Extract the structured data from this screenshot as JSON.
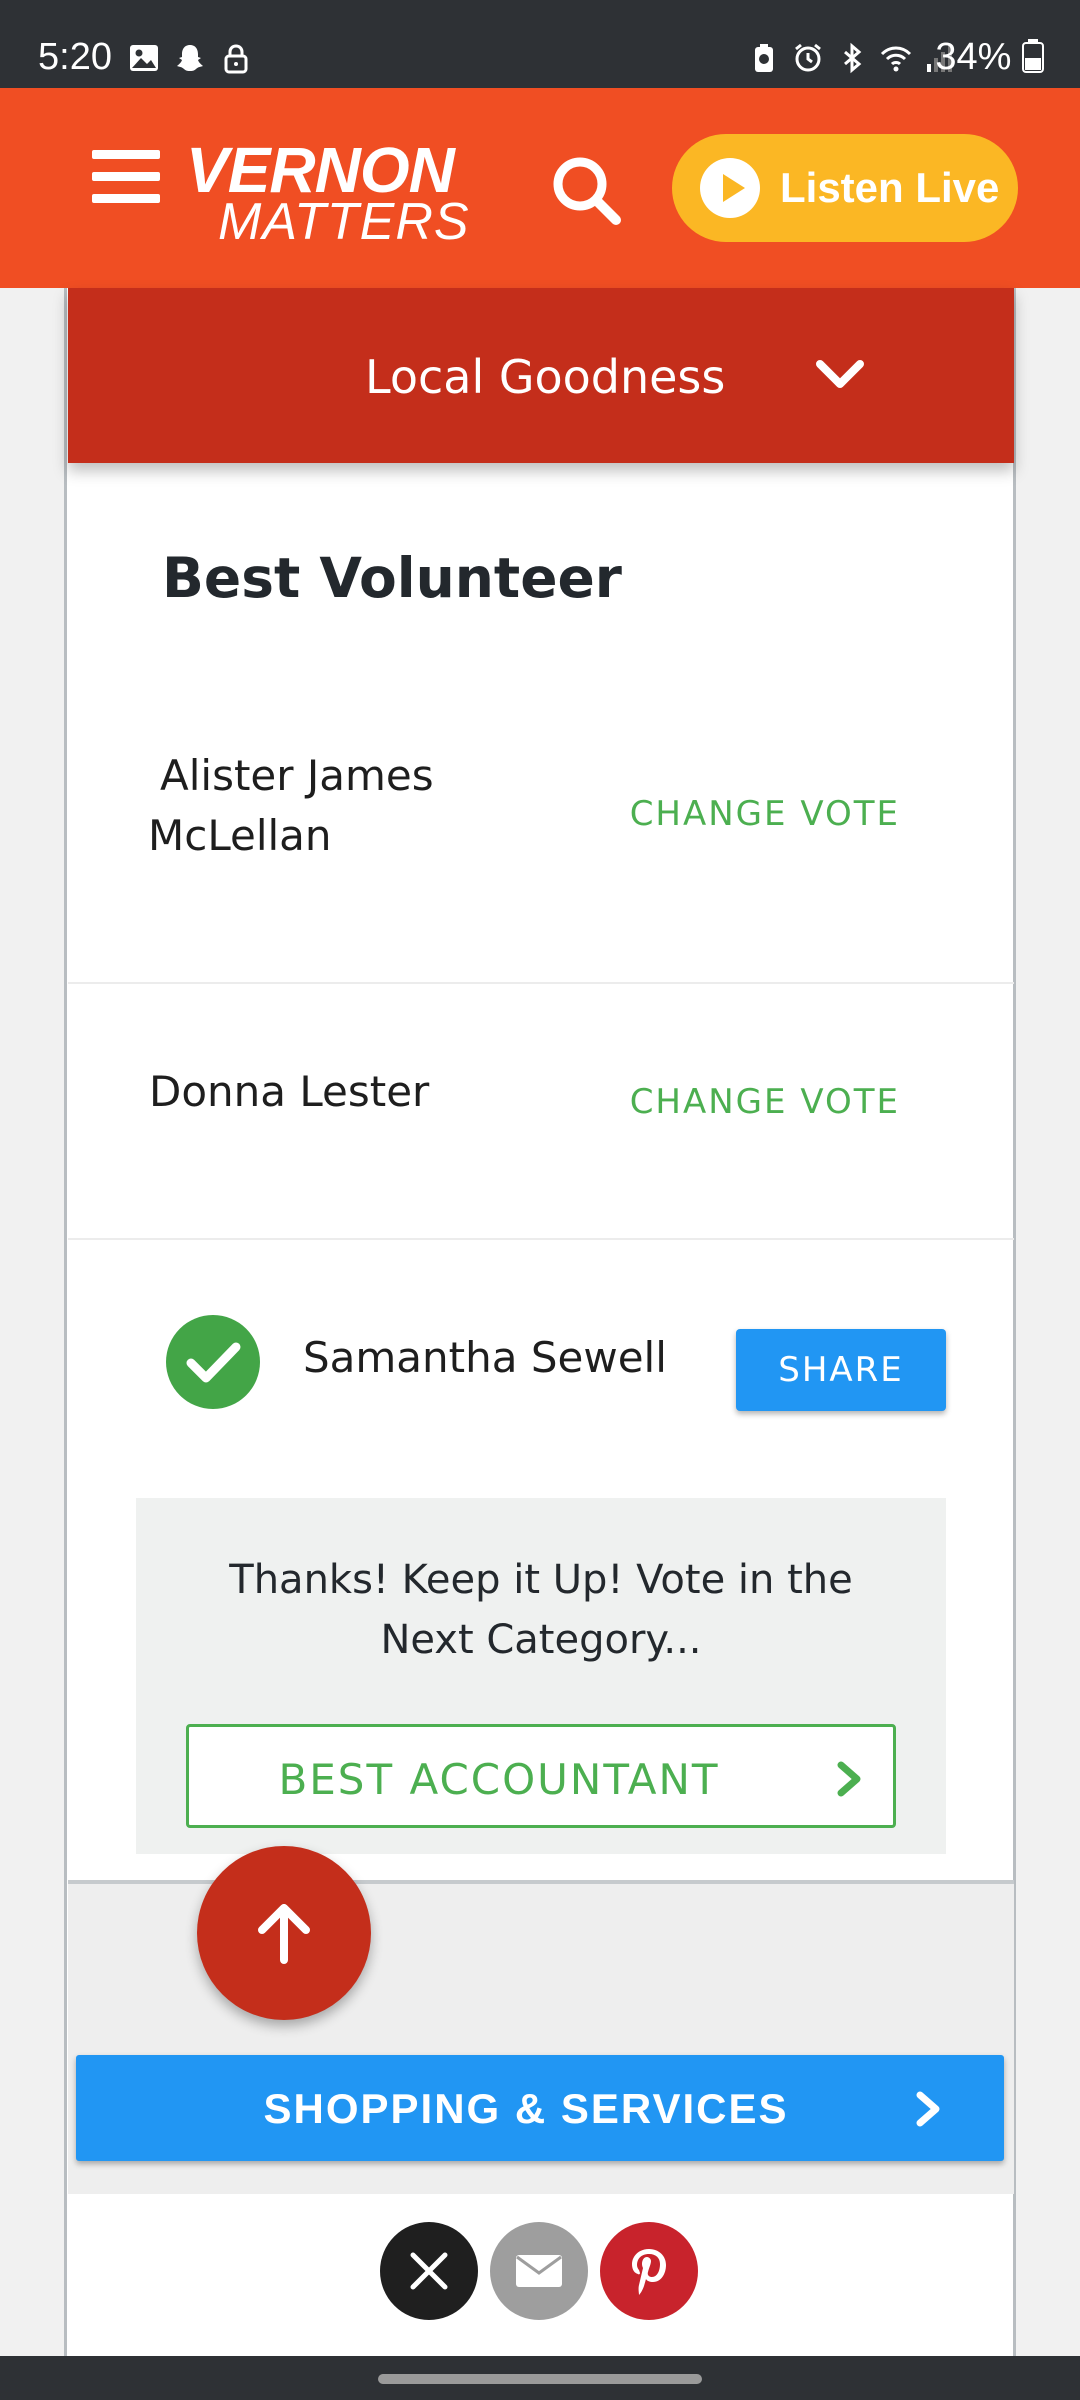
{
  "status_bar": {
    "time": "5:20",
    "battery": "34%",
    "left_icons": [
      "image-icon",
      "snapchat-icon",
      "lock-icon"
    ],
    "right_icons": [
      "battery-saver-icon",
      "alarm-icon",
      "bluetooth-icon",
      "wifi-icon",
      "signal-icon"
    ]
  },
  "header": {
    "logo_top": "VERNON",
    "logo_bottom": "MATTERS",
    "listen_label": "Listen Live",
    "brand_color": "#f04e23",
    "listen_color": "#fbb724"
  },
  "category": {
    "label": "Local Goodness",
    "color": "#c42e1b"
  },
  "section": {
    "title": "Best Volunteer"
  },
  "nominees": [
    {
      "name_line1": "Alister James",
      "name_line2": "McLellan",
      "action": "CHANGE VOTE"
    },
    {
      "name": "Donna Lester",
      "action": "CHANGE VOTE"
    }
  ],
  "voted": {
    "name": "Samantha Sewell",
    "share_label": "SHARE"
  },
  "thanks": {
    "line1": "Thanks! Keep it Up! Vote in the",
    "line2": "Next Category...",
    "next_label": "BEST ACCOUNTANT"
  },
  "shopping": {
    "label": "SHOPPING & SERVICES"
  },
  "social_share": [
    "x-icon",
    "email-icon",
    "pinterest-icon"
  ]
}
